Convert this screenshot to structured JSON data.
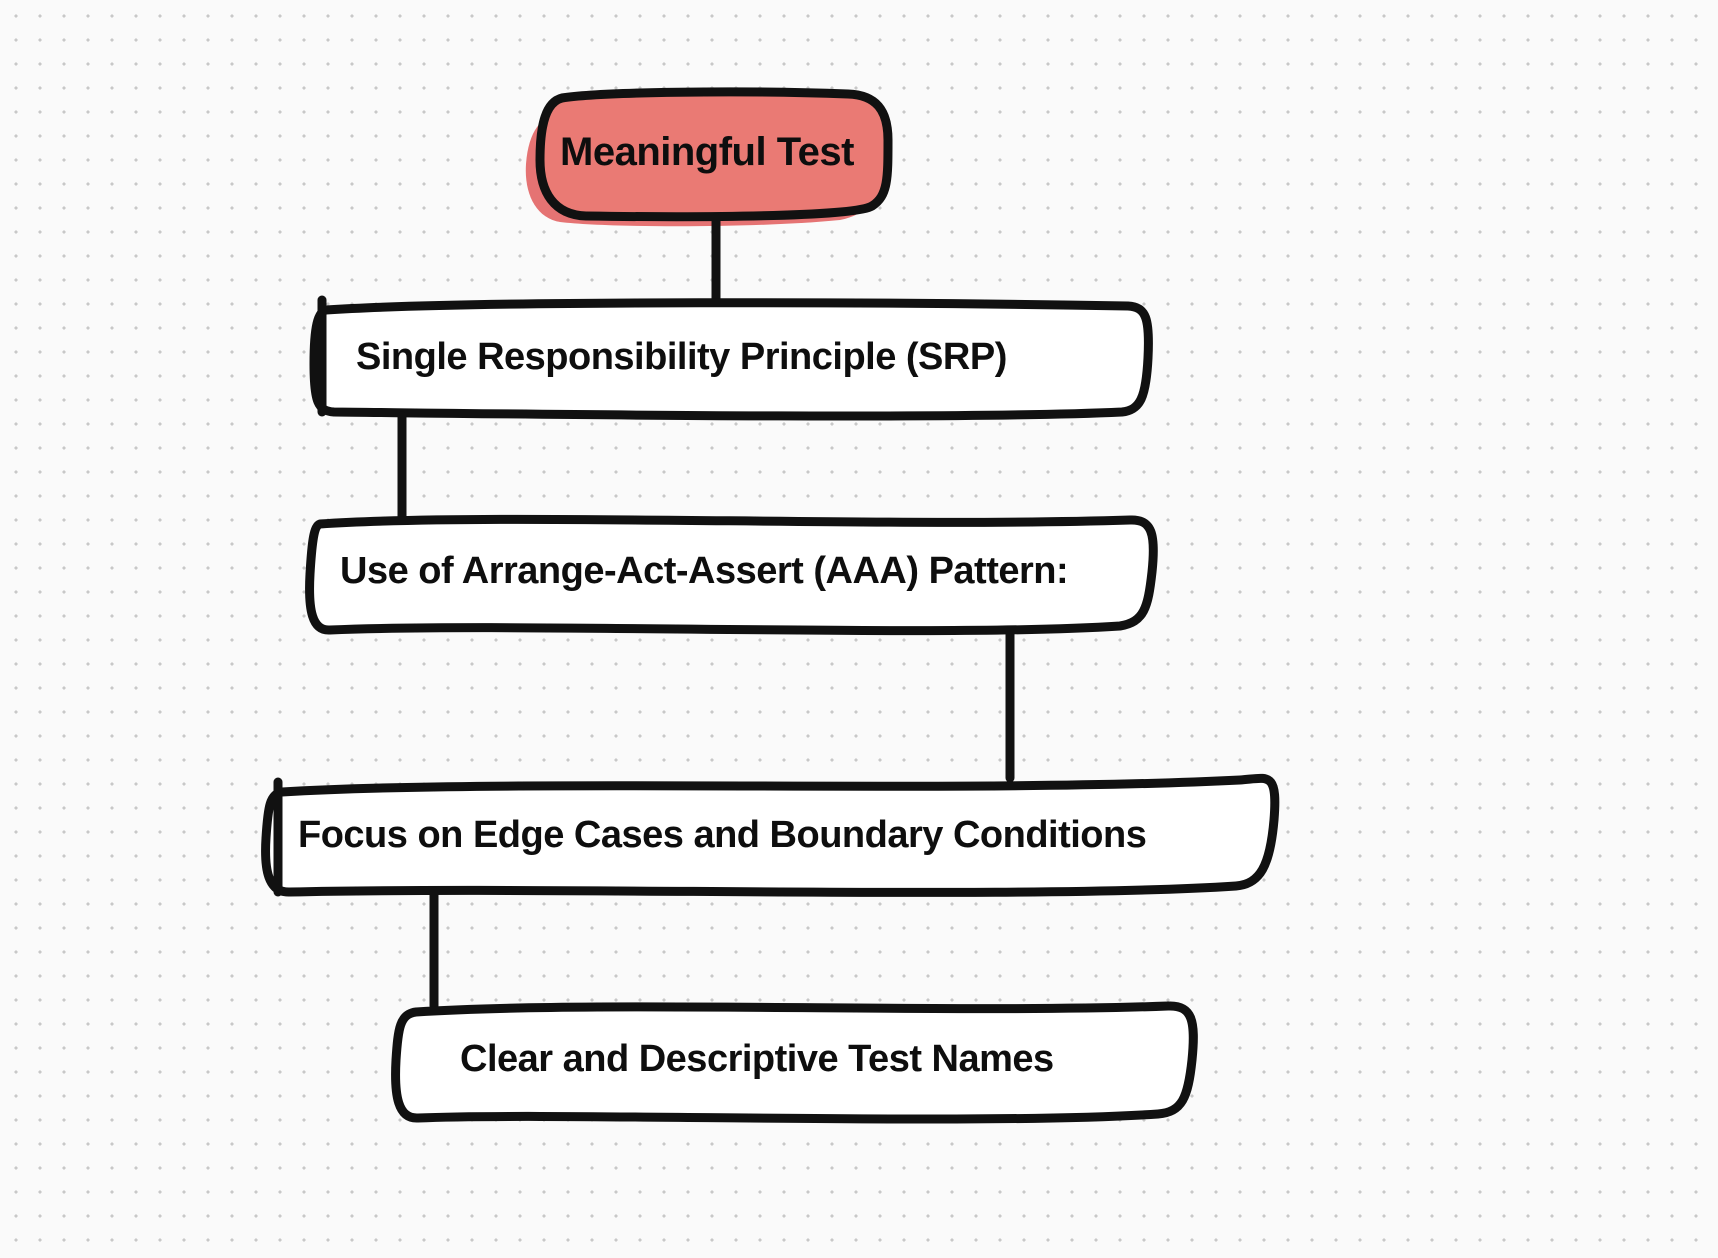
{
  "diagram": {
    "root": {
      "label": "Meaningful Test"
    },
    "nodes": [
      {
        "label": "Single Responsibility Principle (SRP)"
      },
      {
        "label": "Use of Arrange-Act-Assert (AAA) Pattern:"
      },
      {
        "label": "Focus on Edge Cases and Boundary Conditions"
      },
      {
        "label": "Clear and Descriptive Test Names"
      }
    ],
    "colors": {
      "root_fill": "#ea7a74",
      "root_shadow": "#e57373",
      "stroke": "#111111",
      "background": "#fafafa",
      "dot": "#c8c8c8"
    }
  }
}
